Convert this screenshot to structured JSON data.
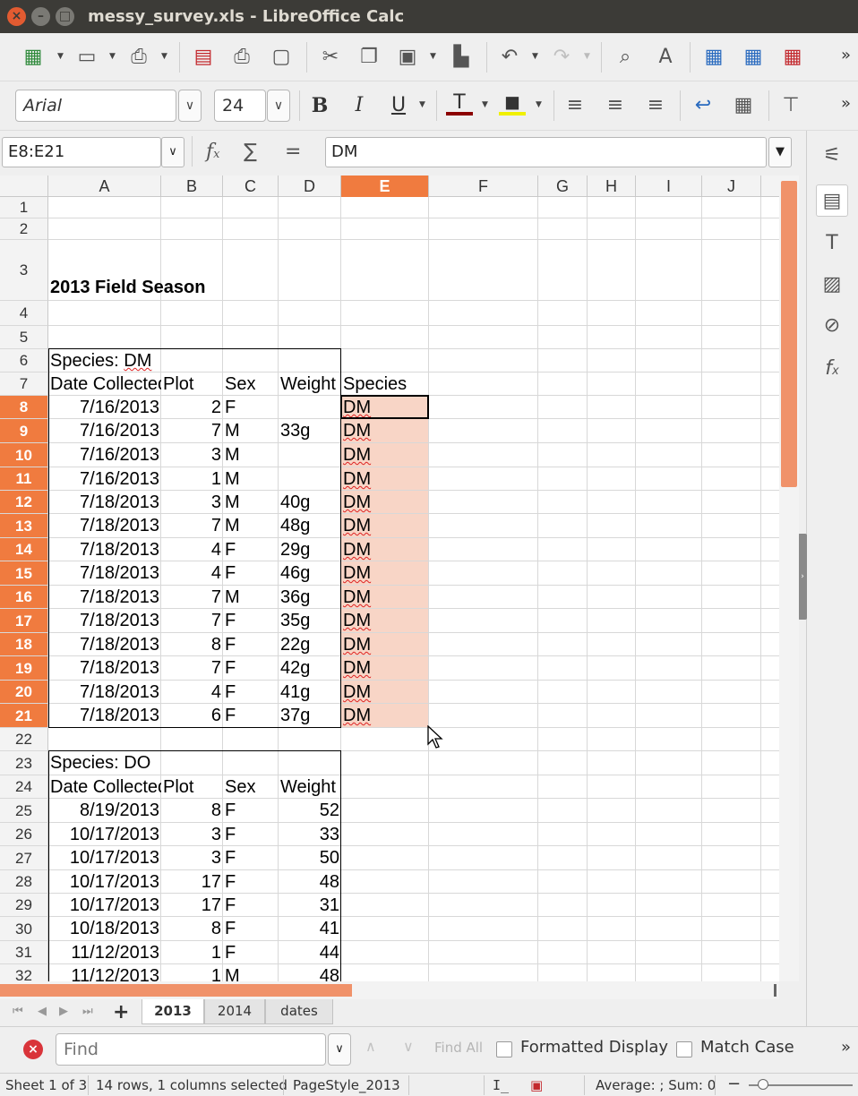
{
  "window": {
    "title": "messy_survey.xls - LibreOffice Calc"
  },
  "toolbar2": {
    "font_name": "Arial",
    "font_size": "24"
  },
  "formula_bar": {
    "name_box": "E8:E21",
    "content": "DM"
  },
  "columns": [
    "A",
    "B",
    "C",
    "D",
    "E",
    "F",
    "G",
    "H",
    "I",
    "J"
  ],
  "selected_column": "E",
  "rows": [
    {
      "n": "1",
      "cells": {}
    },
    {
      "n": "2",
      "cells": {}
    },
    {
      "n": "3",
      "cells": {
        "A": "2013 Field Season"
      }
    },
    {
      "n": "4",
      "cells": {}
    },
    {
      "n": "5",
      "cells": {}
    },
    {
      "n": "6",
      "cells": {
        "A": "Species: DM"
      }
    },
    {
      "n": "7",
      "cells": {
        "A": "Date Collected",
        "B": "Plot",
        "C": "Sex",
        "D": "Weight",
        "E": "Species"
      }
    },
    {
      "n": "8",
      "cells": {
        "A": "7/16/2013",
        "B": "2",
        "C": "F",
        "D": "",
        "E": "DM"
      }
    },
    {
      "n": "9",
      "cells": {
        "A": "7/16/2013",
        "B": "7",
        "C": "M",
        "D": "33g",
        "E": "DM"
      }
    },
    {
      "n": "10",
      "cells": {
        "A": "7/16/2013",
        "B": "3",
        "C": "M",
        "D": "",
        "E": "DM"
      }
    },
    {
      "n": "11",
      "cells": {
        "A": "7/16/2013",
        "B": "1",
        "C": "M",
        "D": "",
        "E": "DM"
      }
    },
    {
      "n": "12",
      "cells": {
        "A": "7/18/2013",
        "B": "3",
        "C": "M",
        "D": "40g",
        "E": "DM"
      }
    },
    {
      "n": "13",
      "cells": {
        "A": "7/18/2013",
        "B": "7",
        "C": "M",
        "D": "48g",
        "E": "DM"
      }
    },
    {
      "n": "14",
      "cells": {
        "A": "7/18/2013",
        "B": "4",
        "C": "F",
        "D": "29g",
        "E": "DM"
      }
    },
    {
      "n": "15",
      "cells": {
        "A": "7/18/2013",
        "B": "4",
        "C": "F",
        "D": "46g",
        "E": "DM"
      }
    },
    {
      "n": "16",
      "cells": {
        "A": "7/18/2013",
        "B": "7",
        "C": "M",
        "D": "36g",
        "E": "DM"
      }
    },
    {
      "n": "17",
      "cells": {
        "A": "7/18/2013",
        "B": "7",
        "C": "F",
        "D": "35g",
        "E": "DM"
      }
    },
    {
      "n": "18",
      "cells": {
        "A": "7/18/2013",
        "B": "8",
        "C": "F",
        "D": "22g",
        "E": "DM"
      }
    },
    {
      "n": "19",
      "cells": {
        "A": "7/18/2013",
        "B": "7",
        "C": "F",
        "D": "42g",
        "E": "DM"
      }
    },
    {
      "n": "20",
      "cells": {
        "A": "7/18/2013",
        "B": "4",
        "C": "F",
        "D": "41g",
        "E": "DM"
      }
    },
    {
      "n": "21",
      "cells": {
        "A": "7/18/2013",
        "B": "6",
        "C": "F",
        "D": "37g",
        "E": "DM"
      }
    },
    {
      "n": "22",
      "cells": {}
    },
    {
      "n": "23",
      "cells": {
        "A": "Species: DO"
      }
    },
    {
      "n": "24",
      "cells": {
        "A": "Date Collected",
        "B": "Plot",
        "C": "Sex",
        "D": "Weight"
      }
    },
    {
      "n": "25",
      "cells": {
        "A": "8/19/2013",
        "B": "8",
        "C": "F",
        "D": "52"
      }
    },
    {
      "n": "26",
      "cells": {
        "A": "10/17/2013",
        "B": "3",
        "C": "F",
        "D": "33"
      }
    },
    {
      "n": "27",
      "cells": {
        "A": "10/17/2013",
        "B": "3",
        "C": "F",
        "D": "50"
      }
    },
    {
      "n": "28",
      "cells": {
        "A": "10/17/2013",
        "B": "17",
        "C": "F",
        "D": "48"
      }
    },
    {
      "n": "29",
      "cells": {
        "A": "10/17/2013",
        "B": "17",
        "C": "F",
        "D": "31"
      }
    },
    {
      "n": "30",
      "cells": {
        "A": "10/18/2013",
        "B": "8",
        "C": "F",
        "D": "41"
      }
    },
    {
      "n": "31",
      "cells": {
        "A": "11/12/2013",
        "B": "1",
        "C": "F",
        "D": "44"
      }
    },
    {
      "n": "32",
      "cells": {
        "A": "11/12/2013",
        "B": "1",
        "C": "M",
        "D": "48"
      }
    }
  ],
  "sheet_tabs": [
    "2013",
    "2014",
    "dates"
  ],
  "active_tab": "2013",
  "find_bar": {
    "placeholder": "Find",
    "find_all": "Find All",
    "formatted_display": "Formatted Display",
    "match_case": "Match Case"
  },
  "status_bar": {
    "sheet": "Sheet 1 of 3",
    "selection": "14 rows, 1 columns selected",
    "page_style": "PageStyle_2013",
    "sum": "Average: ; Sum: 0",
    "zoom_minus": "−"
  },
  "colors": {
    "accent": "#f07b3f",
    "selection": "#f8d5c6",
    "titlebar": "#3c3b37"
  }
}
